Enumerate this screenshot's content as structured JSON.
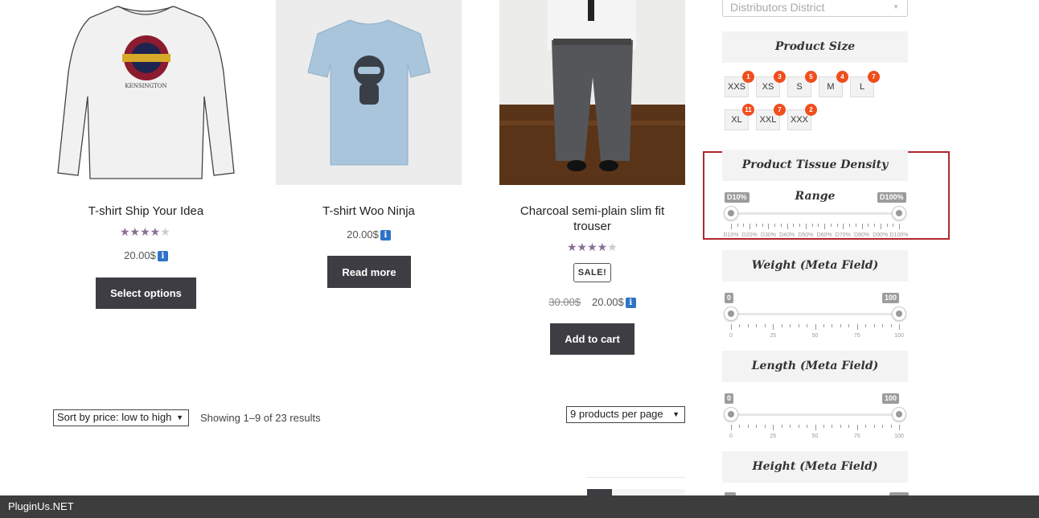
{
  "products": [
    {
      "title": "T-shirt Ship Your Idea",
      "price": "20.00$",
      "rating": 4.5,
      "button": "Select options",
      "logo_text": "KENSINGTON"
    },
    {
      "title": "T-shirt Woo Ninja",
      "price": "20.00$",
      "button": "Read more"
    },
    {
      "title_line1": "Charcoal semi-plain slim fit",
      "title_line2": "trouser",
      "old_price": "30.00$",
      "price": "20.00$",
      "rating": 4.5,
      "sale_badge": "SALE!",
      "button": "Add to cart"
    }
  ],
  "info_icon": "i",
  "sort": {
    "selected": "Sort by price: low to high"
  },
  "result_count": "Showing 1–9 of 23 results",
  "per_page": {
    "selected": "9 products per page"
  },
  "sidebar": {
    "district_placeholder": "Distributors District",
    "size_title": "Product Size",
    "sizes": [
      {
        "label": "XXS",
        "count": "1"
      },
      {
        "label": "XS",
        "count": "3"
      },
      {
        "label": "S",
        "count": "5"
      },
      {
        "label": "M",
        "count": "4"
      },
      {
        "label": "L",
        "count": "7"
      },
      {
        "label": "XL",
        "count": "11"
      },
      {
        "label": "XXL",
        "count": "7"
      },
      {
        "label": "XXX",
        "count": "2"
      }
    ],
    "density": {
      "title": "Product Tissue Density Range",
      "from": "D10%",
      "to": "D100%",
      "labels": [
        "D10%",
        "D20%",
        "D30%",
        "D40%",
        "D50%",
        "D60%",
        "D70%",
        "D80%",
        "D90%",
        "D100%"
      ]
    },
    "weight": {
      "title": "Weight (Meta Field)",
      "from": "0",
      "to": "100",
      "labels": [
        "0",
        "25",
        "50",
        "75",
        "100"
      ]
    },
    "length": {
      "title": "Length (Meta Field)",
      "from": "0",
      "to": "100",
      "labels": [
        "0",
        "25",
        "50",
        "75",
        "100"
      ]
    },
    "height": {
      "title": "Height (Meta Field)"
    }
  },
  "footer": {
    "brand": "PluginUs.NET"
  },
  "colors": {
    "accent_highlight": "#b0282e",
    "button": "#3d3d43",
    "badge": "#f04e1e",
    "star": "#8a6e96"
  }
}
